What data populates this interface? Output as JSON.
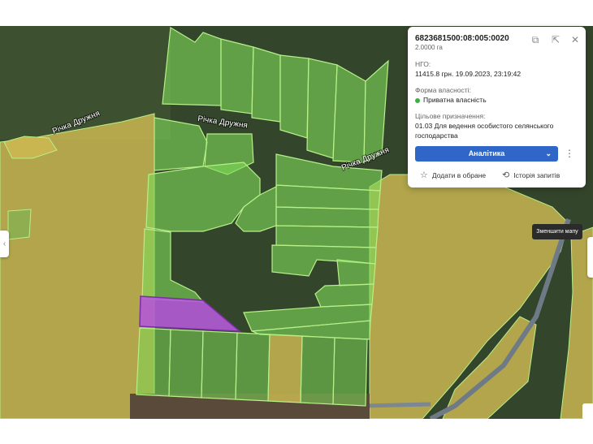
{
  "map": {
    "river_labels": [
      "Річка Дружня",
      "Річка Дружня",
      "Річка Дружня"
    ],
    "colors": {
      "selected_parcel": "#b35ad6",
      "private_parcel": "#7ed957",
      "other_parcel": "#d9c24f",
      "parcel_border": "#b7f08a"
    }
  },
  "parcel_card": {
    "cadastral_number": "6823681500:08:005:0020",
    "area": "2.0000 га",
    "ngo_label": "НГО:",
    "ngo_value": "11415.8 грн. 19.09.2023, 23:19:42",
    "ownership_label": "Форма власності:",
    "ownership_value": "Приватна власність",
    "ownership_color": "#3cb043",
    "purpose_label": "Цільове призначення:",
    "purpose_value_line1": "01.03 Для ведення особистого селянського",
    "purpose_value_line2": "господарства",
    "analytics_button": "Аналітика",
    "favorites_label": "Додати в обране",
    "history_label": "Історія запитів",
    "icons": [
      "copy-icon",
      "external-link-icon",
      "close-icon",
      "chevron-down-icon",
      "more-vertical-icon",
      "star-icon",
      "history-icon"
    ]
  },
  "tooltip": {
    "text": "Зменшити мапу"
  }
}
